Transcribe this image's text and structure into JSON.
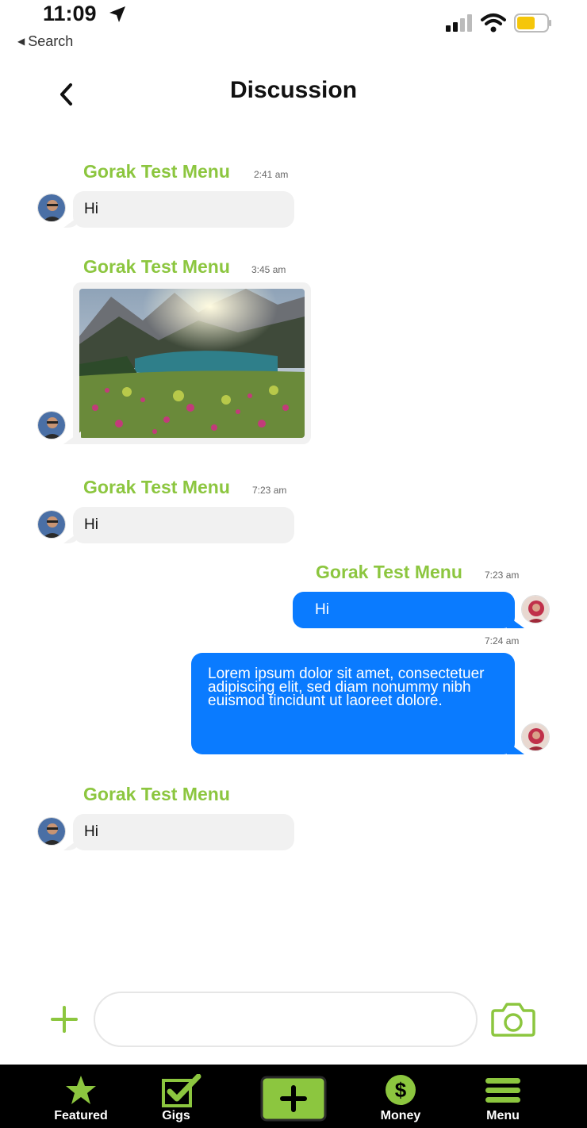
{
  "status_bar": {
    "time": "11:09",
    "back_label": "Search"
  },
  "header": {
    "title": "Discussion"
  },
  "messages": [
    {
      "sender": "Gorak Test Menu",
      "time": "2:41 am",
      "text": "Hi",
      "direction": "incoming"
    },
    {
      "sender": "Gorak Test Menu",
      "time": "3:45 am",
      "type": "image",
      "image_icon": "mountain-lake-landscape",
      "direction": "incoming"
    },
    {
      "sender": "Gorak Test Menu",
      "time": "7:23 am",
      "text": "Hi",
      "direction": "incoming"
    },
    {
      "sender": "Gorak Test Menu",
      "time": "7:23 am",
      "text": "Hi",
      "direction": "outgoing"
    },
    {
      "time": "7:24 am",
      "text": "Lorem ipsum dolor sit amet, consectetuer adipiscing elit, sed diam nonummy nibh euismod tincidunt ut laoreet dolore.",
      "direction": "outgoing"
    },
    {
      "sender": "Gorak Test Menu",
      "text": "Hi",
      "direction": "incoming"
    }
  ],
  "composer": {
    "placeholder": ""
  },
  "tabs": [
    {
      "label": "Featured",
      "icon": "star-icon"
    },
    {
      "label": "Gigs",
      "icon": "checkbox-icon"
    },
    {
      "label": "",
      "icon": "plus-icon"
    },
    {
      "label": "Money",
      "icon": "dollar-icon"
    },
    {
      "label": "Menu",
      "icon": "menu-icon"
    }
  ],
  "colors": {
    "accent_green": "#8cc63f",
    "bubble_blue": "#0a7bff",
    "bubble_gray": "#f1f1f1",
    "tabbar_bg": "#000000"
  }
}
